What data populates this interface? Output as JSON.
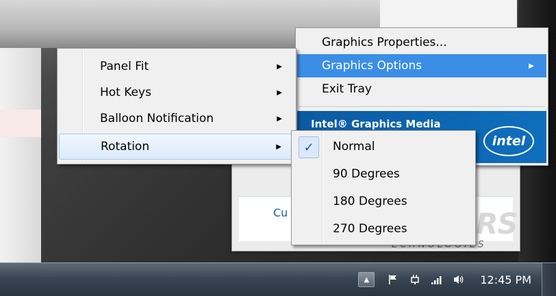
{
  "graphics_menu": {
    "items": [
      {
        "label": "Graphics Properties...",
        "active": false,
        "submenu": false
      },
      {
        "label": "Graphics Options",
        "active": true,
        "submenu": true
      },
      {
        "label": "Exit Tray",
        "active": false,
        "submenu": false
      }
    ],
    "banner_text": "Intel® Graphics Media",
    "logo_text": "intel"
  },
  "options_menu": {
    "items": [
      {
        "label": "Panel Fit",
        "submenu": true
      },
      {
        "label": "Hot Keys",
        "submenu": true
      },
      {
        "label": "Balloon Notification",
        "submenu": true
      },
      {
        "label": "Rotation",
        "submenu": true,
        "highlighted": true
      }
    ]
  },
  "rotation_menu": {
    "items": [
      {
        "label": "Normal",
        "checked": true
      },
      {
        "label": "90 Degrees",
        "checked": false
      },
      {
        "label": "180 Degrees",
        "checked": false
      },
      {
        "label": "270 Degrees",
        "checked": false
      }
    ],
    "check_glyph": "✓"
  },
  "background": {
    "window_link": "Cu",
    "brand_logo": "RS",
    "brand_sub": "ECHNOLOGIES"
  },
  "taskbar": {
    "tray_icons": [
      "show-hidden-icons",
      "action-center-flag-icon",
      "power-plug-icon",
      "network-signal-icon",
      "volume-icon"
    ],
    "clock": "12:45 PM"
  },
  "colors": {
    "menu_bg": "#f0f0f0",
    "selection_blue": "#3a8ee6",
    "intel_blue": "#0e6fbd",
    "taskbar": "#3a4653"
  }
}
